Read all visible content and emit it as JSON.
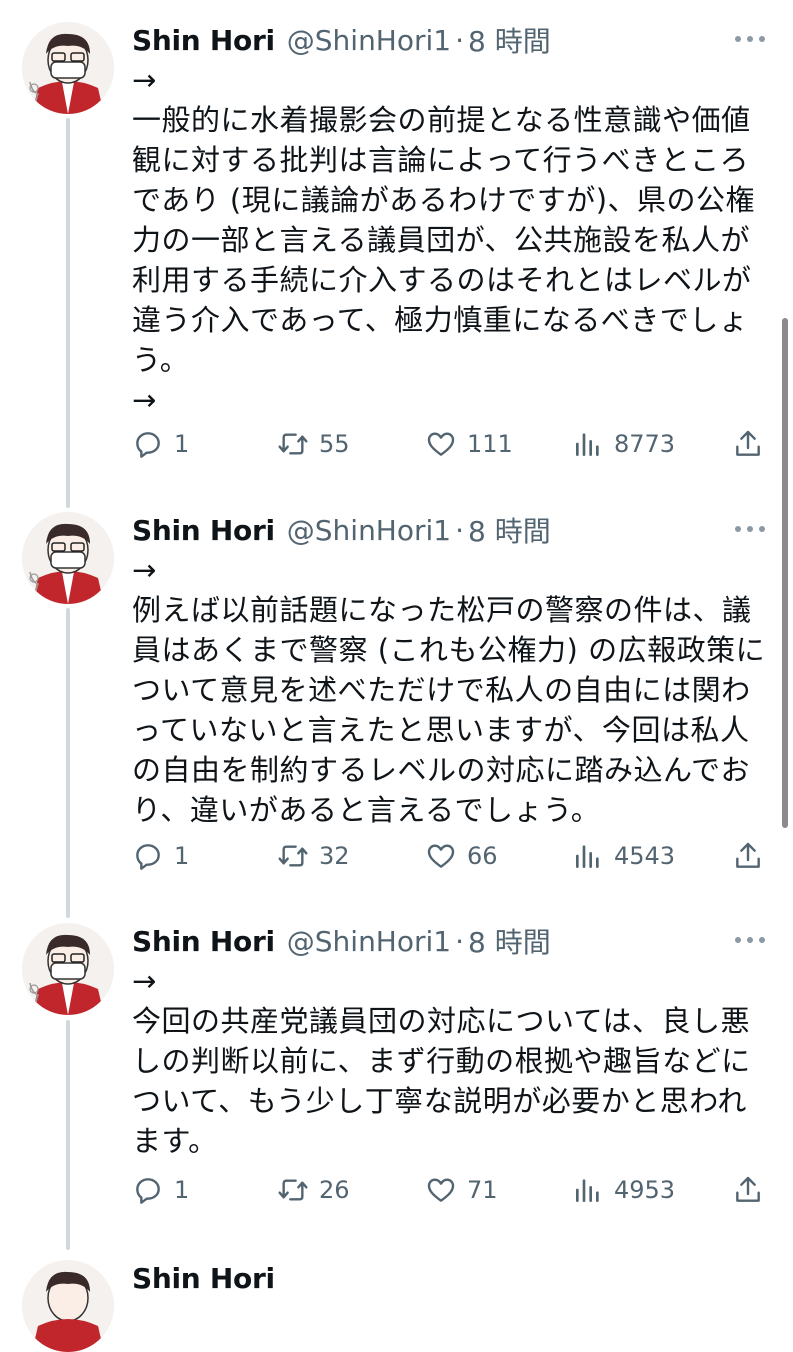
{
  "tweets": [
    {
      "author": "Shin Hori",
      "handle": "@ShinHori1",
      "dot": "·",
      "time": "8 時間",
      "lines": [
        "→",
        "一般的に水着撮影会の前提となる性意識や価値",
        "観に対する批判は言論によって行うべきところ",
        "であり (現に議論があるわけですが)、県の公権",
        "力の一部と言える議員団が、公共施設を私人が",
        "利用する手続に介入するのはそれとはレベルが",
        "違う介入であって、極力慎重になるべきでしょ",
        "う。",
        "→"
      ],
      "replies": "1",
      "retweets": "55",
      "likes": "111",
      "views": "8773"
    },
    {
      "author": "Shin Hori",
      "handle": "@ShinHori1",
      "dot": "·",
      "time": "8 時間",
      "lines": [
        "→",
        "例えば以前話題になった松戸の警察の件は、議",
        "員はあくまで警察 (これも公権力) の広報政策に",
        "ついて意見を述べただけで私人の自由には関わ",
        "っていないと言えたと思いますが、今回は私人",
        "の自由を制約するレベルの対応に踏み込んでお",
        "り、違いがあると言えるでしょう。"
      ],
      "replies": "1",
      "retweets": "32",
      "likes": "66",
      "views": "4543"
    },
    {
      "author": "Shin Hori",
      "handle": "@ShinHori1",
      "dot": "·",
      "time": "8 時間",
      "lines": [
        "→",
        "今回の共産党議員団の対応については、良し悪",
        "しの判断以前に、まず行動の根拠や趣旨などに",
        "ついて、もう少し丁寧な説明が必要かと思われ",
        "ます。"
      ],
      "replies": "1",
      "retweets": "26",
      "likes": "71",
      "views": "4953"
    },
    {
      "author": "Shin Hori"
    }
  ],
  "colors": {
    "text": "#0f1419",
    "secondary": "#536471",
    "thread": "#cfd9de",
    "avatar_red": "#c0262c"
  },
  "icons": [
    "reply-icon",
    "retweet-icon",
    "like-icon",
    "views-icon",
    "share-icon",
    "more-icon",
    "avatar"
  ]
}
